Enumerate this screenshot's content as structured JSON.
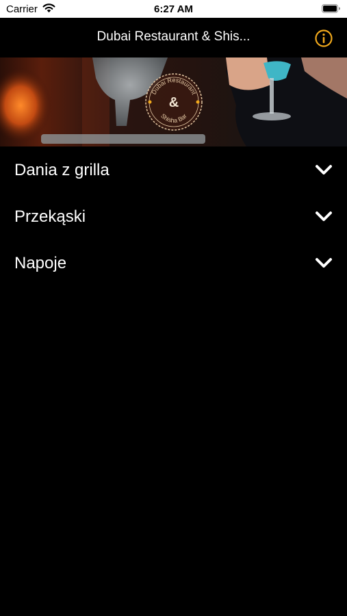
{
  "status_bar": {
    "carrier": "Carrier",
    "time": "6:27 AM",
    "wifi_icon": "wifi-icon",
    "battery_icon": "battery-icon"
  },
  "nav": {
    "title": "Dubai Restaurant & Shis...",
    "info_icon": "info-circle-icon",
    "accent_color": "#F0A81C"
  },
  "banner": {
    "logo_lines": [
      "Dubai Restaurant",
      "&",
      "Shisha Bar"
    ],
    "logo_color": "#E3C7A3"
  },
  "categories": [
    {
      "label": "Dania z grilla",
      "icon": "chevron-down-icon"
    },
    {
      "label": "Przekąski",
      "icon": "chevron-down-icon"
    },
    {
      "label": "Napoje",
      "icon": "chevron-down-icon"
    }
  ]
}
